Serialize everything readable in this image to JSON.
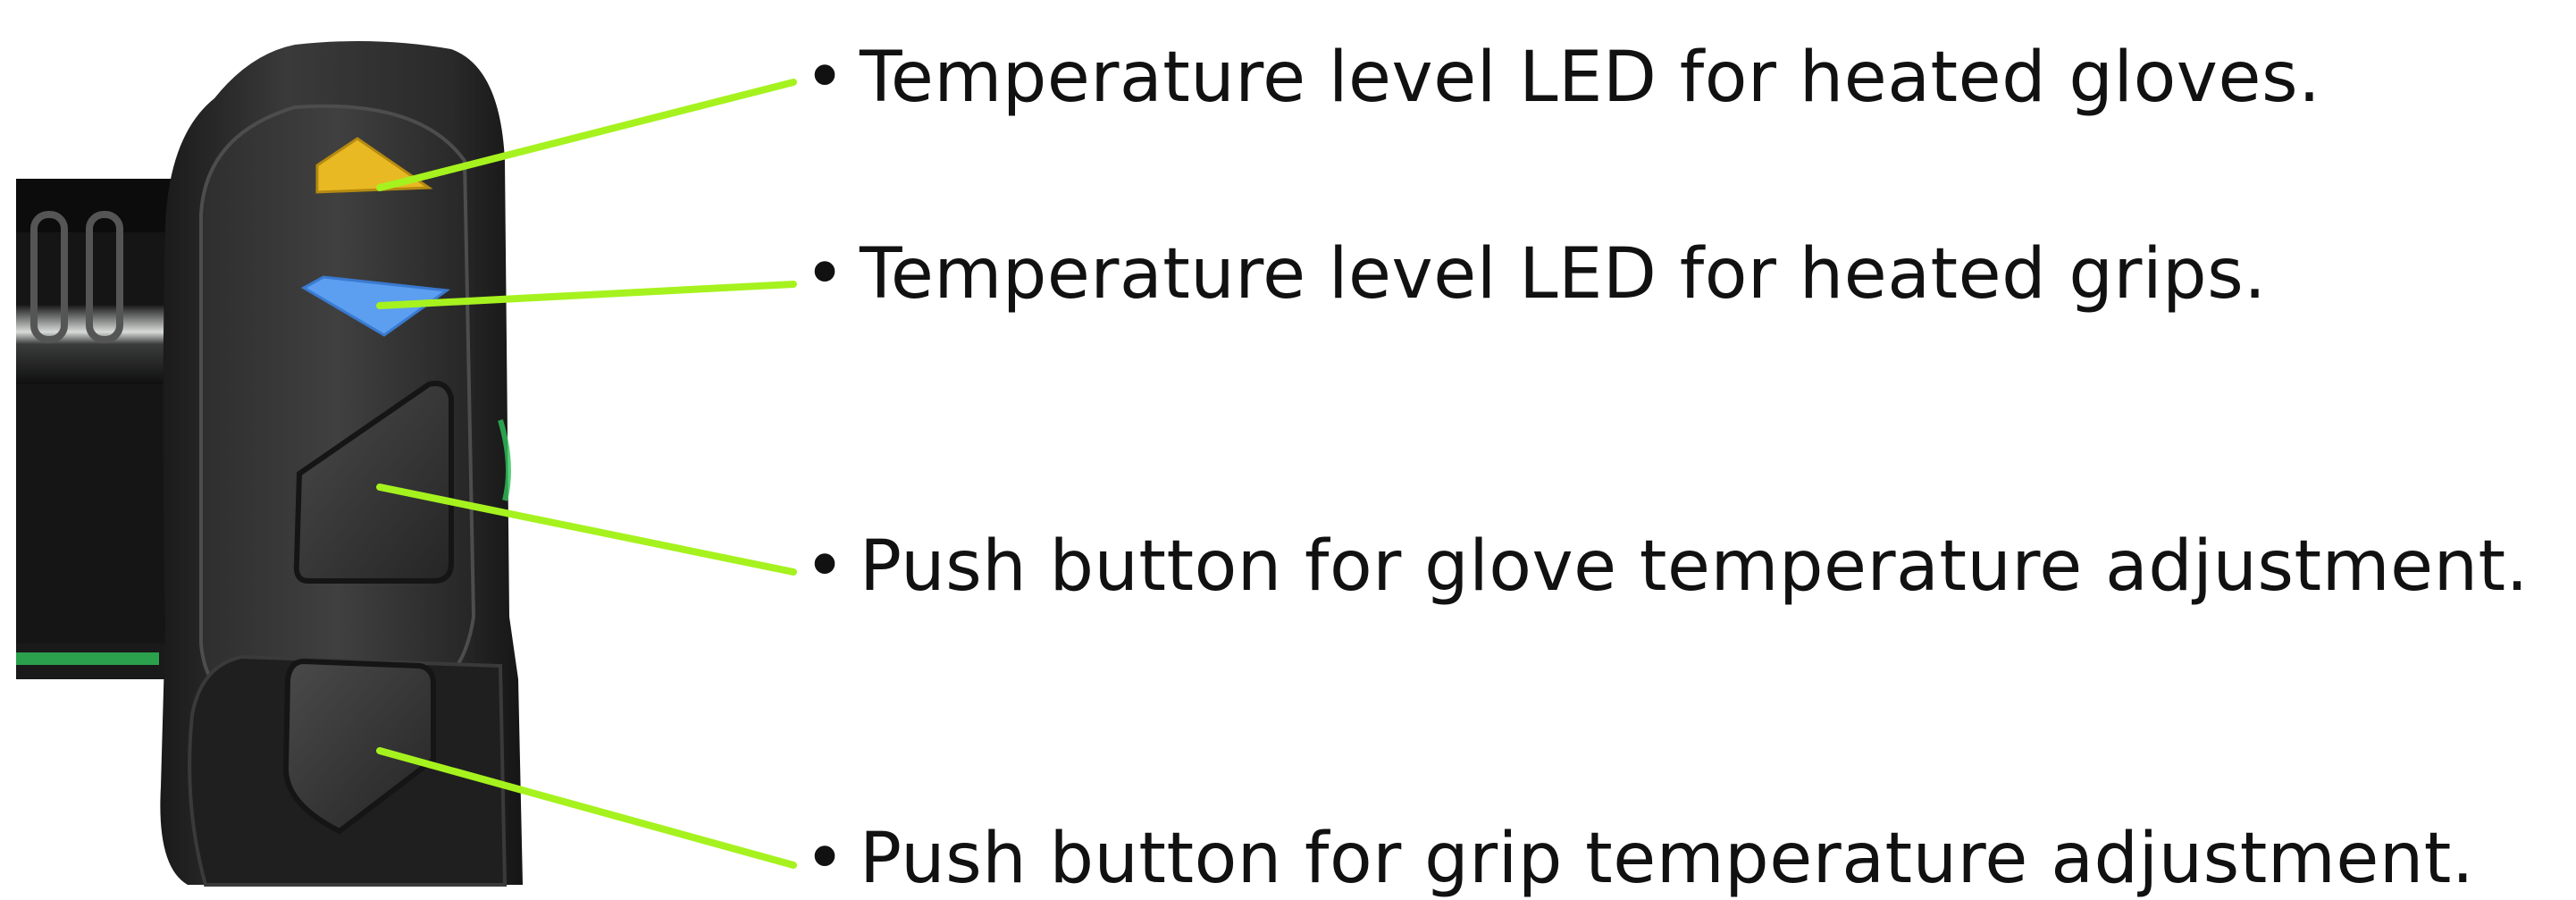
{
  "colors": {
    "leader_line": "#a6f21e",
    "glove_led": "#e8b923",
    "grip_led": "#5c9ef0",
    "housing": "#2b2b2b",
    "handlebar_accent": "#2fc25a"
  },
  "callouts": [
    {
      "bullet": "•",
      "text": "Temperature level LED for heated gloves."
    },
    {
      "bullet": "•",
      "text": "Temperature level LED for heated grips."
    },
    {
      "bullet": "•",
      "text": "Push button for glove temperature adjustment."
    },
    {
      "bullet": "•",
      "text": "Push button for grip temperature adjustment."
    }
  ]
}
